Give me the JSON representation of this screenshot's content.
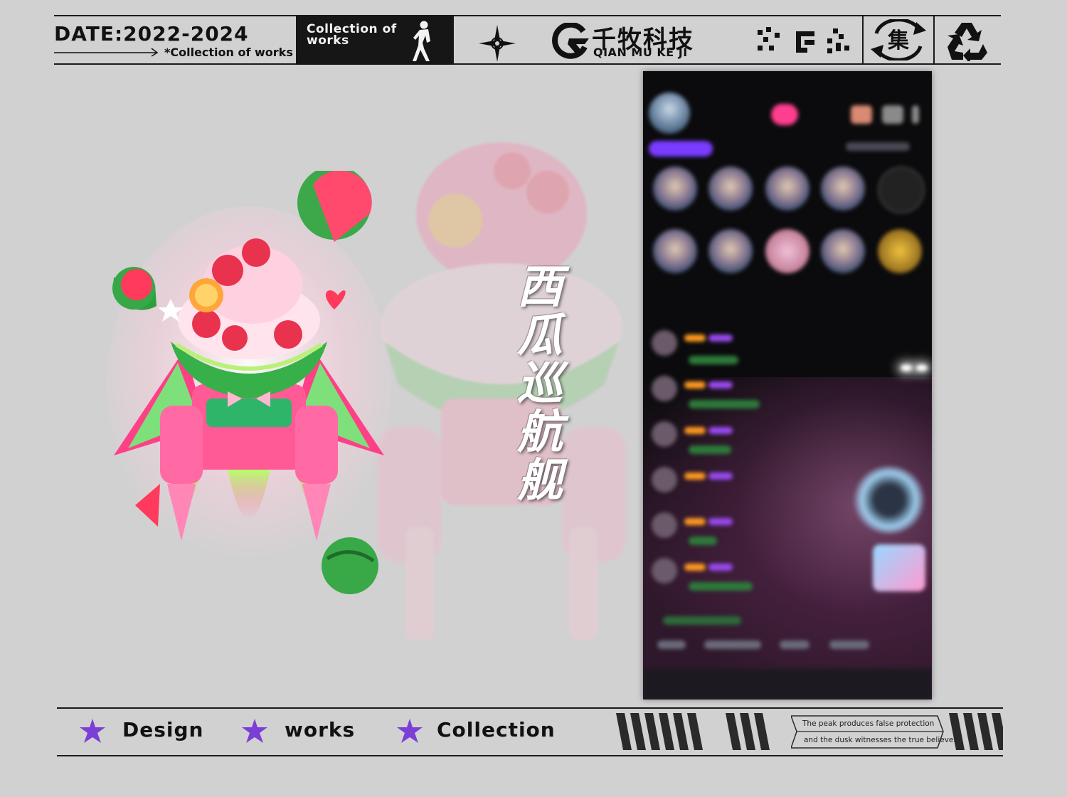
{
  "header": {
    "date": "DATE:2022-2024",
    "subtitle": "*Collection of works",
    "black_label": "Collection of works",
    "brand_cn": "千牧科技",
    "brand_pinyin": "QIAN MU KE JI",
    "badge_char": "集"
  },
  "art": {
    "title_vertical": "西瓜巡航舰"
  },
  "footer": {
    "words": [
      "Design",
      "works",
      "Collection"
    ],
    "quote_line1": "The peak produces false protection",
    "quote_line2": "and the dusk witnesses the true believers"
  },
  "colors": {
    "background": "#d1d1d1",
    "ink": "#111111",
    "star_accent": "#7b3fd6",
    "phone_bg": "#0b0b0d",
    "watermelon_pink": "#ff4f8f",
    "watermelon_green": "#3fa845"
  },
  "icons": [
    "compass-star-icon",
    "g-arrow-logo-icon",
    "pixel-glyphs-icon",
    "collect-badge-icon",
    "recycle-icon",
    "dancer-figure-icon",
    "purple-star-icon"
  ]
}
